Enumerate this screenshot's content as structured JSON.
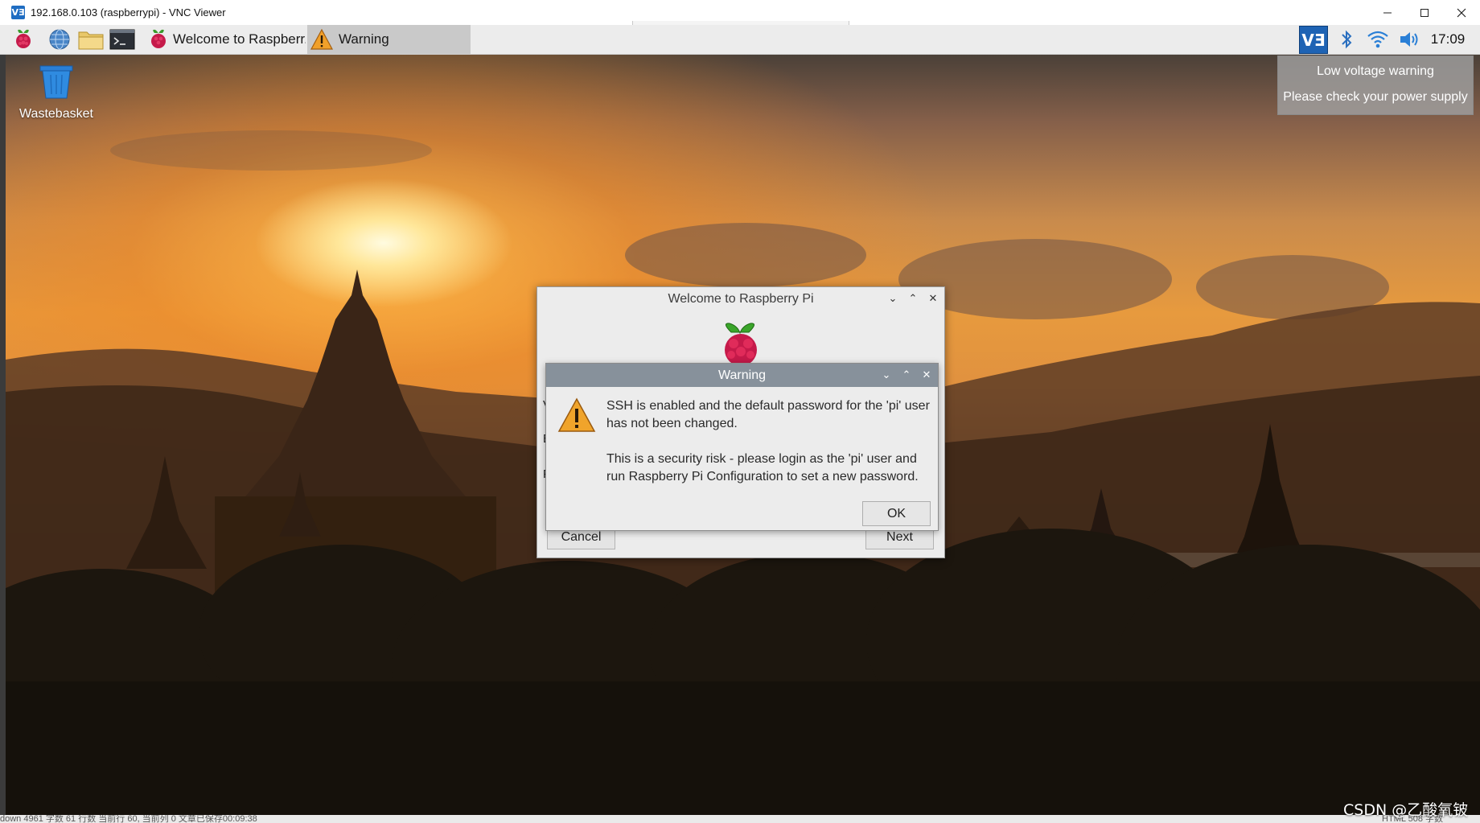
{
  "vnc_window": {
    "app_icon_text": "VƎ",
    "title": "192.168.0.103 (raspberrypi) - VNC Viewer",
    "controls": {
      "minimize": "—",
      "maximize": "☐",
      "close": "✕"
    }
  },
  "taskbar": {
    "launchers": [
      {
        "name": "raspberry-menu-icon"
      },
      {
        "name": "web-browser-icon"
      },
      {
        "name": "file-manager-icon"
      },
      {
        "name": "terminal-icon"
      }
    ],
    "tasks": [
      {
        "label": "Welcome to Raspberr...",
        "icon": "raspberry-icon",
        "active": false
      },
      {
        "label": "Warning",
        "icon": "warning-icon",
        "active": true
      }
    ],
    "tray": {
      "vnc_label": "VƎ",
      "clock": "17:09"
    }
  },
  "notification": {
    "line1": "Low voltage warning",
    "line2": "Please check your power supply"
  },
  "desktop": {
    "icons": [
      {
        "label": "Wastebasket",
        "icon": "trash-icon"
      }
    ]
  },
  "welcome_dialog": {
    "title": "Welcome to Raspberry Pi",
    "controls": {
      "minimize": "⌄",
      "maximize": "⌃",
      "close": "✕"
    },
    "partial_letters": [
      "V",
      "E",
      "F"
    ],
    "cancel_label": "Cancel",
    "next_label": "Next"
  },
  "warning_dialog": {
    "title": "Warning",
    "controls": {
      "minimize": "⌄",
      "maximize": "⌃",
      "close": "✕"
    },
    "message_line1": "SSH is enabled and the default password for the 'pi' user has not been changed.",
    "message_line2": "This is a security risk - please login as the 'pi' user and run Raspberry Pi Configuration to set a new password.",
    "ok_label": "OK"
  },
  "host_status": {
    "left_text": "down 4961 字数 61 行数 当前行 60, 当前列 0 文章已保存00:09:38",
    "right_text": "HTML 508 字数",
    "watermark": "CSDN @乙酸氧铍"
  },
  "colors": {
    "taskbar_bg": "#ececec",
    "warning_titlebar": "#87919b",
    "dialog_bg": "#ececec",
    "vnc_tray_bg": "#1e63b4"
  }
}
